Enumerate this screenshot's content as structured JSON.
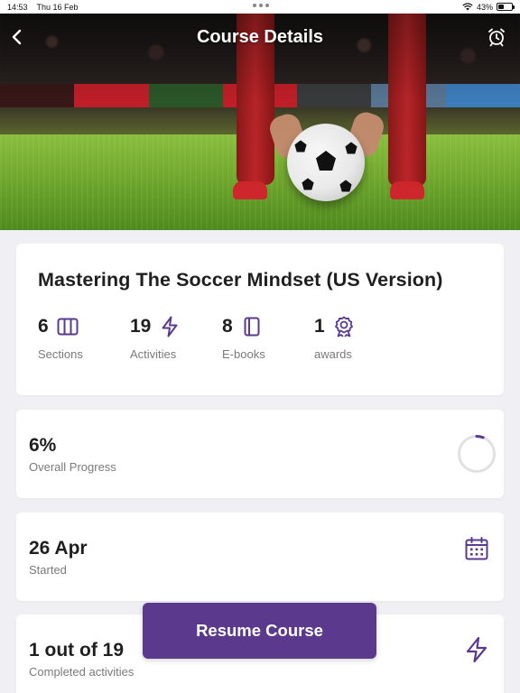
{
  "status_bar": {
    "time": "14:53",
    "date": "Thu 16 Feb",
    "battery_percent": "43%",
    "battery_level": 0.43
  },
  "header": {
    "title": "Course Details",
    "back_icon": "chevron-left-icon",
    "alarm_icon": "alarm-clock-icon"
  },
  "course": {
    "title": "Mastering The Soccer Mindset (US Version)",
    "stats": [
      {
        "value": "6",
        "label": "Sections",
        "icon": "columns-icon"
      },
      {
        "value": "19",
        "label": "Activities",
        "icon": "lightning-bolt-icon"
      },
      {
        "value": "8",
        "label": "E-books",
        "icon": "book-icon"
      },
      {
        "value": "1",
        "label": "awards",
        "icon": "award-ribbon-icon"
      }
    ]
  },
  "progress": {
    "value": "6%",
    "label": "Overall Progress",
    "fraction": 0.06
  },
  "started": {
    "value": "26 Apr",
    "label": "Started",
    "icon": "calendar-icon"
  },
  "activities": {
    "value": "1 out of 19",
    "label": "Completed activities",
    "icon": "lightning-bolt-icon"
  },
  "resume_button": {
    "label": "Resume Course"
  },
  "colors": {
    "accent": "#5b3a8e",
    "background": "#f0eff4",
    "card": "#ffffff",
    "muted_text": "#7a7a7a"
  }
}
